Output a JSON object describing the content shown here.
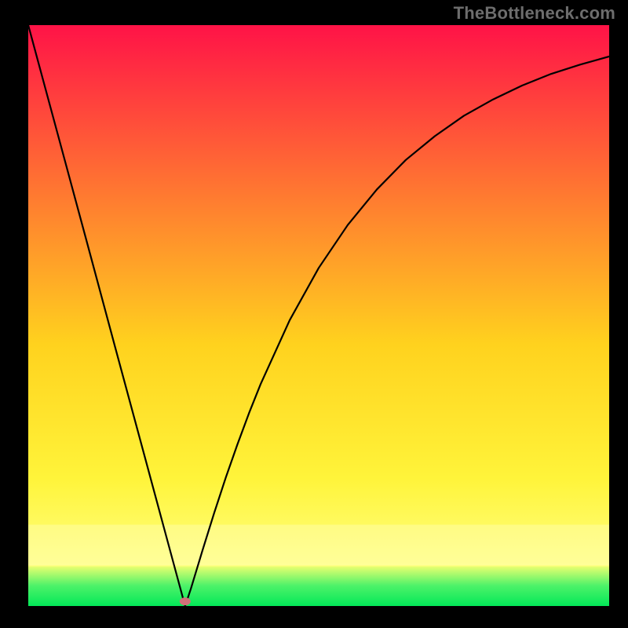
{
  "watermark": "TheBottleneck.com",
  "chart_data": {
    "type": "line",
    "title": "",
    "xlabel": "",
    "ylabel": "",
    "xlim": [
      0,
      100
    ],
    "ylim": [
      0,
      100
    ],
    "x": [
      0,
      5,
      10,
      15,
      20,
      24,
      26,
      27,
      28,
      30,
      32,
      34,
      36,
      38,
      40,
      45,
      50,
      55,
      60,
      65,
      70,
      75,
      80,
      85,
      90,
      95,
      100
    ],
    "values": [
      100,
      81.5,
      63,
      44.4,
      25.9,
      11.1,
      3.7,
      0,
      3,
      9.6,
      16,
      22.1,
      27.8,
      33.2,
      38.2,
      49.2,
      58.2,
      65.6,
      71.7,
      76.8,
      80.9,
      84.4,
      87.2,
      89.6,
      91.6,
      93.2,
      94.6
    ],
    "upper_bar_y": 7.0,
    "background_gradient": {
      "top": "#ff1347",
      "upper_mid": "#ff7c30",
      "mid": "#ffd21e",
      "lower_mid": "#fff43a",
      "green_top": "#4df269",
      "green_bot": "#03e858"
    },
    "marker": {
      "x": 27,
      "y": 0.8,
      "color": "#d07079"
    }
  }
}
